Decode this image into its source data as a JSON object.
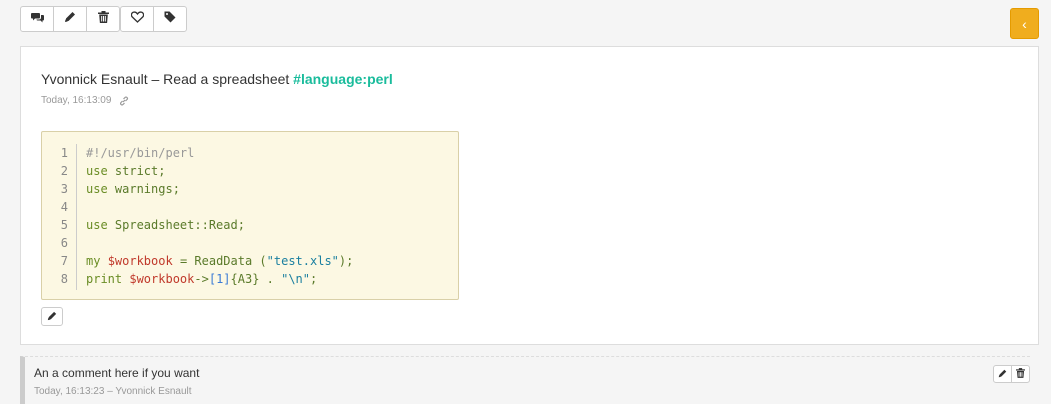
{
  "toolbar": {
    "buttons": [
      {
        "icon": "comments-icon"
      },
      {
        "icon": "pencil-icon"
      },
      {
        "icon": "trash-icon"
      },
      {
        "icon": "heart-icon"
      },
      {
        "icon": "tag-icon"
      }
    ],
    "toggle_label": "‹",
    "toggle_color": "#f0ad1e"
  },
  "post": {
    "author_title": "Yvonnick Esnault – Read a spreadsheet ",
    "tag": "#language:perl",
    "tag_color": "#1abc9c",
    "timestamp": "Today, 16:13:09",
    "link_icon": "link-icon"
  },
  "code": {
    "line_numbers": [
      "1",
      "2",
      "3",
      "4",
      "5",
      "6",
      "7",
      "8"
    ],
    "lines": [
      [
        {
          "t": "#!/usr/bin/perl",
          "c": "comment"
        }
      ],
      [
        {
          "t": "use ",
          "c": "kw"
        },
        {
          "t": "strict;",
          "c": "plain"
        }
      ],
      [
        {
          "t": "use ",
          "c": "kw"
        },
        {
          "t": "warnings;",
          "c": "plain"
        }
      ],
      [],
      [
        {
          "t": "use ",
          "c": "kw"
        },
        {
          "t": "Spreadsheet::Read;",
          "c": "plain"
        }
      ],
      [],
      [
        {
          "t": "my ",
          "c": "kw"
        },
        {
          "t": "$workbook",
          "c": "var"
        },
        {
          "t": " = ReadData (",
          "c": "plain"
        },
        {
          "t": "\"test.xls\"",
          "c": "str"
        },
        {
          "t": ");",
          "c": "plain"
        }
      ],
      [
        {
          "t": "print ",
          "c": "kw"
        },
        {
          "t": "$workbook",
          "c": "var"
        },
        {
          "t": "->",
          "c": "plain"
        },
        {
          "t": "[1]",
          "c": "num"
        },
        {
          "t": "{A3} . ",
          "c": "plain"
        },
        {
          "t": "\"\\n\"",
          "c": "str"
        },
        {
          "t": ";",
          "c": "plain"
        }
      ]
    ],
    "edit_icon": "pencil-icon"
  },
  "comment": {
    "text": "An a comment here if you want",
    "meta": "Today, 16:13:23 – Yvonnick Esnault",
    "actions": [
      {
        "icon": "pencil-icon"
      },
      {
        "icon": "trash-icon"
      }
    ]
  }
}
